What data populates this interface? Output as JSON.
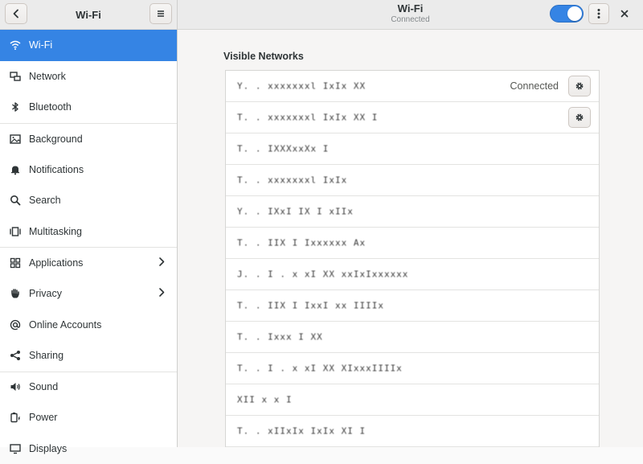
{
  "sidebar": {
    "title": "Wi-Fi",
    "items": [
      {
        "label": "Wi-Fi",
        "icon": "wifi-icon"
      },
      {
        "label": "Network",
        "icon": "network-icon"
      },
      {
        "label": "Bluetooth",
        "icon": "bluetooth-icon"
      },
      {
        "label": "Background",
        "icon": "background-icon"
      },
      {
        "label": "Notifications",
        "icon": "bell-icon"
      },
      {
        "label": "Search",
        "icon": "search-icon"
      },
      {
        "label": "Multitasking",
        "icon": "multitasking-icon"
      },
      {
        "label": "Applications",
        "icon": "applications-icon"
      },
      {
        "label": "Privacy",
        "icon": "hand-icon"
      },
      {
        "label": "Online Accounts",
        "icon": "at-icon"
      },
      {
        "label": "Sharing",
        "icon": "share-icon"
      },
      {
        "label": "Sound",
        "icon": "speaker-icon"
      },
      {
        "label": "Power",
        "icon": "power-icon"
      },
      {
        "label": "Displays",
        "icon": "display-icon"
      }
    ]
  },
  "header": {
    "title": "Wi-Fi",
    "subtitle": "Connected",
    "wifi_enabled": true
  },
  "content": {
    "section_label": "Visible Networks",
    "networks": [
      {
        "ssid": "Y. . xxxxxxxl IxIx XX",
        "status": "Connected",
        "has_settings": true
      },
      {
        "ssid": "T. . xxxxxxxl IxIx XX I",
        "status": "",
        "has_settings": true
      },
      {
        "ssid": "T. . IXXXxxXx I",
        "status": "",
        "has_settings": false
      },
      {
        "ssid": "T. . xxxxxxxl IxIx",
        "status": "",
        "has_settings": false
      },
      {
        "ssid": "Y. . IXxI IX I xIIx",
        "status": "",
        "has_settings": false
      },
      {
        "ssid": "T. . IIX I Ixxxxxx Ax",
        "status": "",
        "has_settings": false
      },
      {
        "ssid": "J. . I . x xI XX xxIxIxxxxxx",
        "status": "",
        "has_settings": false
      },
      {
        "ssid": "T. . IIX I IxxI xx IIIIx",
        "status": "",
        "has_settings": false
      },
      {
        "ssid": "T. . Ixxx I XX",
        "status": "",
        "has_settings": false
      },
      {
        "ssid": "T. . I . x xI XX XIxxxIIIIx",
        "status": "",
        "has_settings": false
      },
      {
        "ssid": "XII x x I",
        "status": "",
        "has_settings": false
      },
      {
        "ssid": "T. . xIIxIx IxIx XI I",
        "status": "",
        "has_settings": false
      }
    ]
  },
  "colors": {
    "accent": "#3584e4",
    "header_bg": "#ebebeb",
    "content_bg": "#f6f5f4"
  }
}
